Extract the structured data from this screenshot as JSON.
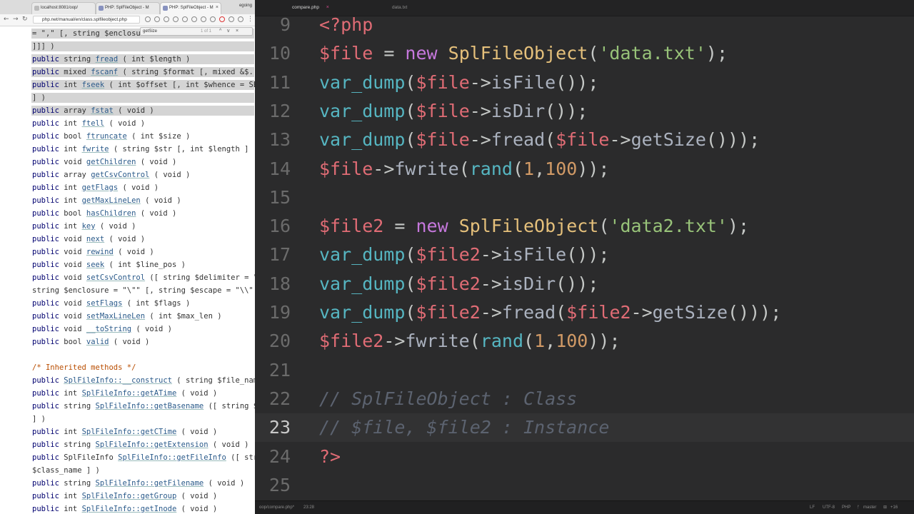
{
  "browser": {
    "tabs": [
      {
        "label": "localhost:8081/oop/"
      },
      {
        "label": "PHP: SplFileObject - M"
      },
      {
        "label": "PHP: SplFileObject - M"
      }
    ],
    "profile": "egoing",
    "url": "php.net/manual/en/class.splfileobject.php",
    "find": {
      "query": "getSize",
      "count": "1 of 1",
      "up": "^",
      "down": "v",
      "close": "×"
    }
  },
  "doc_lines": [
    {
      "t": "= \",\" [, string $enclosu",
      "style": "hl"
    },
    {
      "t": "]]] )",
      "style": "hl"
    },
    {
      "kw": "public",
      "ty": "string",
      "fn": "fread",
      "args": "( int $length )",
      "style": "hl"
    },
    {
      "kw": "public",
      "ty": "mixed",
      "fn": "fscanf",
      "args": "( string $format [, mixed &$...",
      "style": "hl"
    },
    {
      "kw": "public",
      "ty": "int",
      "fn": "fseek",
      "args": "( int $offset [, int $whence = SE",
      "style": "hl"
    },
    {
      "t": "] )",
      "style": "hl"
    },
    {
      "kw": "public",
      "ty": "array",
      "fn": "fstat",
      "args": "( void )",
      "style": "hl"
    },
    {
      "kw": "public",
      "ty": "int",
      "fn": "ftell",
      "args": "( void )"
    },
    {
      "kw": "public",
      "ty": "bool",
      "fn": "ftruncate",
      "args": "( int $size )"
    },
    {
      "kw": "public",
      "ty": "int",
      "fn": "fwrite",
      "args": "( string $str [, int $length ]"
    },
    {
      "kw": "public",
      "ty": "void",
      "fn": "getChildren",
      "args": "( void )"
    },
    {
      "kw": "public",
      "ty": "array",
      "fn": "getCsvControl",
      "args": "( void )"
    },
    {
      "kw": "public",
      "ty": "int",
      "fn": "getFlags",
      "args": "( void )"
    },
    {
      "kw": "public",
      "ty": "int",
      "fn": "getMaxLineLen",
      "args": "( void )"
    },
    {
      "kw": "public",
      "ty": "bool",
      "fn": "hasChildren",
      "args": "( void )"
    },
    {
      "kw": "public",
      "ty": "int",
      "fn": "key",
      "args": "( void )"
    },
    {
      "kw": "public",
      "ty": "void",
      "fn": "next",
      "args": "( void )"
    },
    {
      "kw": "public",
      "ty": "void",
      "fn": "rewind",
      "args": "( void )"
    },
    {
      "kw": "public",
      "ty": "void",
      "fn": "seek",
      "args": "( int $line_pos )"
    },
    {
      "kw": "public",
      "ty": "void",
      "fn": "setCsvControl",
      "args": "([ string $delimiter = \","
    },
    {
      "t": "string $enclosure = \"\\\"\" [, string $escape = \"\\\\\""
    },
    {
      "kw": "public",
      "ty": "void",
      "fn": "setFlags",
      "args": "( int $flags )"
    },
    {
      "kw": "public",
      "ty": "void",
      "fn": "setMaxLineLen",
      "args": "( int $max_len )"
    },
    {
      "kw": "public",
      "ty": "void",
      "fn": "__toString",
      "args": "( void )"
    },
    {
      "kw": "public",
      "ty": "bool",
      "fn": "valid",
      "args": "( void )"
    },
    {
      "t": ""
    },
    {
      "cm": "/* Inherited methods */"
    },
    {
      "kw": "public",
      "ty": "",
      "fn": "SplFileInfo::__construct",
      "args": "( string $file_nam"
    },
    {
      "kw": "public",
      "ty": "int",
      "fn": "SplFileInfo::getATime",
      "args": "( void )"
    },
    {
      "kw": "public",
      "ty": "string",
      "fn": "SplFileInfo::getBasename",
      "args": "([ string $"
    },
    {
      "t": "] )"
    },
    {
      "kw": "public",
      "ty": "int",
      "fn": "SplFileInfo::getCTime",
      "args": "( void )"
    },
    {
      "kw": "public",
      "ty": "string",
      "fn": "SplFileInfo::getExtension",
      "args": "( void )"
    },
    {
      "kw": "public",
      "ty": "SplFileInfo",
      "fn": "SplFileInfo::getFileInfo",
      "args": "([ str"
    },
    {
      "t": "$class_name ] )"
    },
    {
      "kw": "public",
      "ty": "string",
      "fn": "SplFileInfo::getFilename",
      "args": "( void )"
    },
    {
      "kw": "public",
      "ty": "int",
      "fn": "SplFileInfo::getGroup",
      "args": "( void )"
    },
    {
      "kw": "public",
      "ty": "int",
      "fn": "SplFileInfo::getInode",
      "args": "( void )"
    }
  ],
  "editor": {
    "tabs": [
      {
        "label": "compare.php",
        "close": "×"
      },
      {
        "label": "data.txt"
      }
    ],
    "current_line": "23",
    "lines": [
      {
        "n": "9",
        "tokens": [
          [
            "tag",
            "<?php"
          ]
        ]
      },
      {
        "n": "10",
        "tokens": [
          [
            "var",
            "$file"
          ],
          [
            "op",
            " = "
          ],
          [
            "kw",
            "new"
          ],
          [
            "op",
            " "
          ],
          [
            "cls",
            "SplFileObject"
          ],
          [
            "op",
            "("
          ],
          [
            "str",
            "'data.txt'"
          ],
          [
            "op",
            ");"
          ]
        ]
      },
      {
        "n": "11",
        "tokens": [
          [
            "fn",
            "var_dump"
          ],
          [
            "op",
            "("
          ],
          [
            "var",
            "$file"
          ],
          [
            "op",
            "->"
          ],
          [
            "meth",
            "isFile"
          ],
          [
            "op",
            "());"
          ]
        ]
      },
      {
        "n": "12",
        "tokens": [
          [
            "fn",
            "var_dump"
          ],
          [
            "op",
            "("
          ],
          [
            "var",
            "$file"
          ],
          [
            "op",
            "->"
          ],
          [
            "meth",
            "isDir"
          ],
          [
            "op",
            "());"
          ]
        ]
      },
      {
        "n": "13",
        "tokens": [
          [
            "fn",
            "var_dump"
          ],
          [
            "op",
            "("
          ],
          [
            "var",
            "$file"
          ],
          [
            "op",
            "->"
          ],
          [
            "meth",
            "fread"
          ],
          [
            "op",
            "("
          ],
          [
            "var",
            "$file"
          ],
          [
            "op",
            "->"
          ],
          [
            "meth",
            "getSize"
          ],
          [
            "op",
            "()));"
          ]
        ]
      },
      {
        "n": "14",
        "tokens": [
          [
            "var",
            "$file"
          ],
          [
            "op",
            "->"
          ],
          [
            "meth",
            "fwrite"
          ],
          [
            "op",
            "("
          ],
          [
            "fn",
            "rand"
          ],
          [
            "op",
            "("
          ],
          [
            "num",
            "1"
          ],
          [
            "op",
            ","
          ],
          [
            "num",
            "100"
          ],
          [
            "op",
            "));"
          ]
        ]
      },
      {
        "n": "15",
        "tokens": []
      },
      {
        "n": "16",
        "tokens": [
          [
            "var",
            "$file2"
          ],
          [
            "op",
            " = "
          ],
          [
            "kw",
            "new"
          ],
          [
            "op",
            " "
          ],
          [
            "cls",
            "SplFileObject"
          ],
          [
            "op",
            "("
          ],
          [
            "str",
            "'data2.txt'"
          ],
          [
            "op",
            ");"
          ]
        ]
      },
      {
        "n": "17",
        "tokens": [
          [
            "fn",
            "var_dump"
          ],
          [
            "op",
            "("
          ],
          [
            "var",
            "$file2"
          ],
          [
            "op",
            "->"
          ],
          [
            "meth",
            "isFile"
          ],
          [
            "op",
            "());"
          ]
        ]
      },
      {
        "n": "18",
        "tokens": [
          [
            "fn",
            "var_dump"
          ],
          [
            "op",
            "("
          ],
          [
            "var",
            "$file2"
          ],
          [
            "op",
            "->"
          ],
          [
            "meth",
            "isDir"
          ],
          [
            "op",
            "());"
          ]
        ]
      },
      {
        "n": "19",
        "tokens": [
          [
            "fn",
            "var_dump"
          ],
          [
            "op",
            "("
          ],
          [
            "var",
            "$file2"
          ],
          [
            "op",
            "->"
          ],
          [
            "meth",
            "fread"
          ],
          [
            "op",
            "("
          ],
          [
            "var",
            "$file2"
          ],
          [
            "op",
            "->"
          ],
          [
            "meth",
            "getSize"
          ],
          [
            "op",
            "()));"
          ]
        ]
      },
      {
        "n": "20",
        "tokens": [
          [
            "var",
            "$file2"
          ],
          [
            "op",
            "->"
          ],
          [
            "meth",
            "fwrite"
          ],
          [
            "op",
            "("
          ],
          [
            "fn",
            "rand"
          ],
          [
            "op",
            "("
          ],
          [
            "num",
            "1"
          ],
          [
            "op",
            ","
          ],
          [
            "num",
            "100"
          ],
          [
            "op",
            "));"
          ]
        ]
      },
      {
        "n": "21",
        "tokens": []
      },
      {
        "n": "22",
        "tokens": [
          [
            "cm",
            "// SplFileObject : Class"
          ]
        ]
      },
      {
        "n": "23",
        "tokens": [
          [
            "cm",
            "// $file, $file2 : Instance"
          ]
        ]
      },
      {
        "n": "24",
        "tokens": [
          [
            "tag",
            "?>"
          ]
        ]
      },
      {
        "n": "25",
        "tokens": []
      }
    ]
  },
  "status": {
    "file": "oop/compare.php*",
    "cursor": "23:28",
    "eol": "LF",
    "encoding": "UTF-8",
    "grammar": "PHP",
    "branch": "master",
    "changes": "+16"
  },
  "colors": {
    "editor_bg": "#2b2b2c",
    "variable": "#e06c75",
    "keyword": "#c678dd",
    "class": "#e5c07b",
    "function": "#56b6c2",
    "string": "#98c379",
    "number": "#d19a66",
    "comment": "#5c6370"
  }
}
